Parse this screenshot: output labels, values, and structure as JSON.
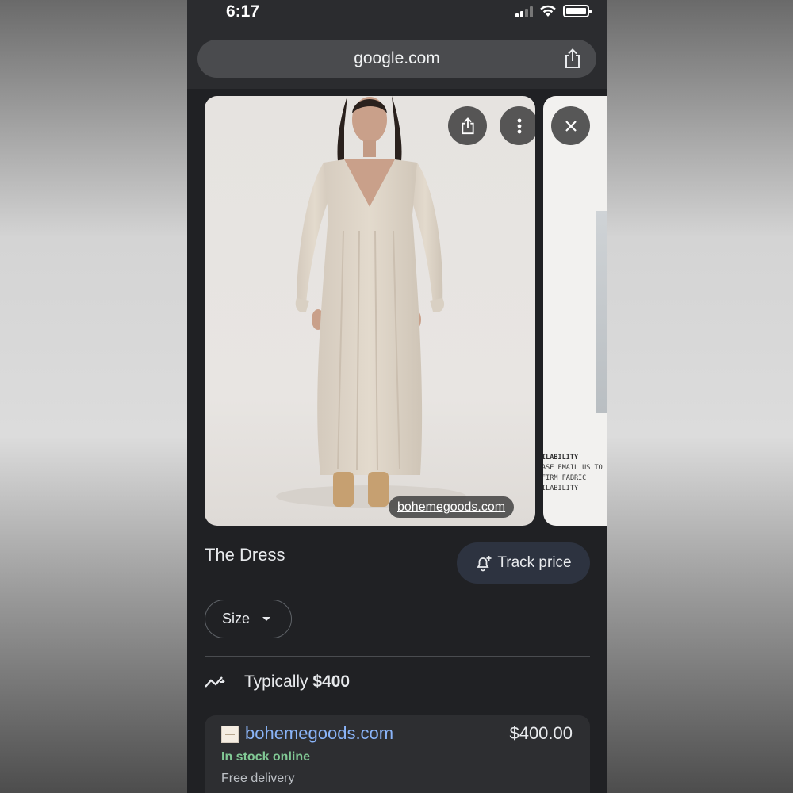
{
  "status_bar": {
    "time": "6:17"
  },
  "browser": {
    "url": "google.com"
  },
  "image_card": {
    "source_chip": "bohemegoods.com"
  },
  "next_card": {
    "heading": "ILABILITY",
    "lines": [
      "ASE EMAIL US TO",
      "FIRM FABRIC",
      "ILABILITY"
    ]
  },
  "product": {
    "title": "The Dress",
    "track_price_label": "Track price",
    "size_label": "Size",
    "typical_prefix": "Typically",
    "typical_price": "$400"
  },
  "offer": {
    "site": "bohemegoods.com",
    "price": "$400.00",
    "stock": "In stock online",
    "delivery": "Free delivery"
  },
  "colors": {
    "background": "#202124",
    "link": "#8ab4f8",
    "in_stock": "#81c995",
    "track_button": "#2d3340"
  },
  "icons": [
    "signal-icon",
    "wifi-icon",
    "battery-icon",
    "share-icon",
    "more-vert-icon",
    "close-icon",
    "add-alert-icon",
    "dropdown-caret-icon",
    "trending-icon"
  ]
}
